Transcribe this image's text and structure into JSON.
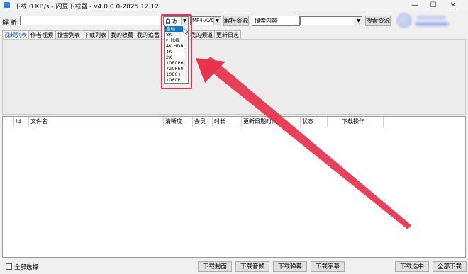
{
  "window": {
    "title": "下载:0 KB/s - 闪豆下载器 - v4.0.0.0-2025.12.12",
    "icons": [
      "app-icon",
      "minimize-icon",
      "maximize-icon",
      "close-icon"
    ],
    "minimize_glyph": "—",
    "maximize_glyph": "☐",
    "close_glyph": "✕"
  },
  "toolbar": {
    "parse_label": "解 析:",
    "url_value": "",
    "quality_value": "自动",
    "codec_value": "MP4-AVC",
    "parse_button": "解析资源",
    "search_value": "搜索内容",
    "search_type_value": "",
    "search_button": "搜索资源",
    "dropdown_arrow": "▼"
  },
  "quality_options": [
    "自动",
    "8K",
    "杜比视",
    "4K HDR",
    "4K",
    "2K",
    "1080P6",
    "720P60",
    "1080+",
    "1080P"
  ],
  "tabs": [
    "视频列表",
    "作者视频",
    "搜索列表",
    "下载列表",
    "我的收藏",
    "我的追番",
    "我的频道",
    "更新日志"
  ],
  "active_tab": "视频列表",
  "table": {
    "columns": [
      "",
      "id",
      "文件名",
      "清晰度",
      "会员",
      "时长",
      "更新日期时间",
      "状态",
      "下载操作"
    ],
    "rows": []
  },
  "bottom": {
    "select_all": "全部选择",
    "buttons": [
      "下载封面",
      "下载音频",
      "下载弹幕",
      "下载字幕",
      "下载选中",
      "全部下载"
    ]
  },
  "colors": {
    "annotation": "#e8334d",
    "selected_option": "#0078d7",
    "active_tab_text": "#1040c0"
  }
}
